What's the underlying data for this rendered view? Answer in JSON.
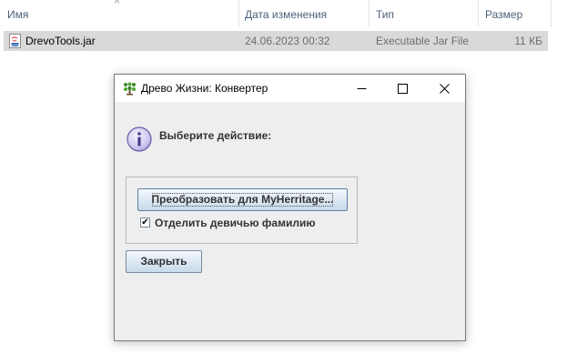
{
  "explorer": {
    "columns": {
      "name": "Имя",
      "modified": "Дата изменения",
      "type": "Тип",
      "size": "Размер"
    },
    "file": {
      "name": "DrevoTools.jar",
      "modified": "24.06.2023 00:32",
      "type": "Executable Jar File",
      "size": "11 КБ",
      "icon": "jar-file-icon"
    }
  },
  "dialog": {
    "title": "Древо Жизни: Конвертер",
    "app_icon": "tree-app-icon",
    "controls": {
      "minimize": "minimize-icon",
      "maximize": "maximize-icon",
      "close": "close-icon"
    },
    "message_icon": "info-icon",
    "prompt": "Выберите действие:",
    "convert_button": "Преобразовать для MyHerritage...",
    "checkbox": {
      "label": "Отделить девичью фамилию",
      "checked": true,
      "mark": "✔"
    },
    "close_button": "Закрыть"
  },
  "colors": {
    "selection": "#d9d9d9",
    "dialog_bg": "#eeeeee",
    "header_text": "#4c607a",
    "button_border": "#7a8a99"
  }
}
